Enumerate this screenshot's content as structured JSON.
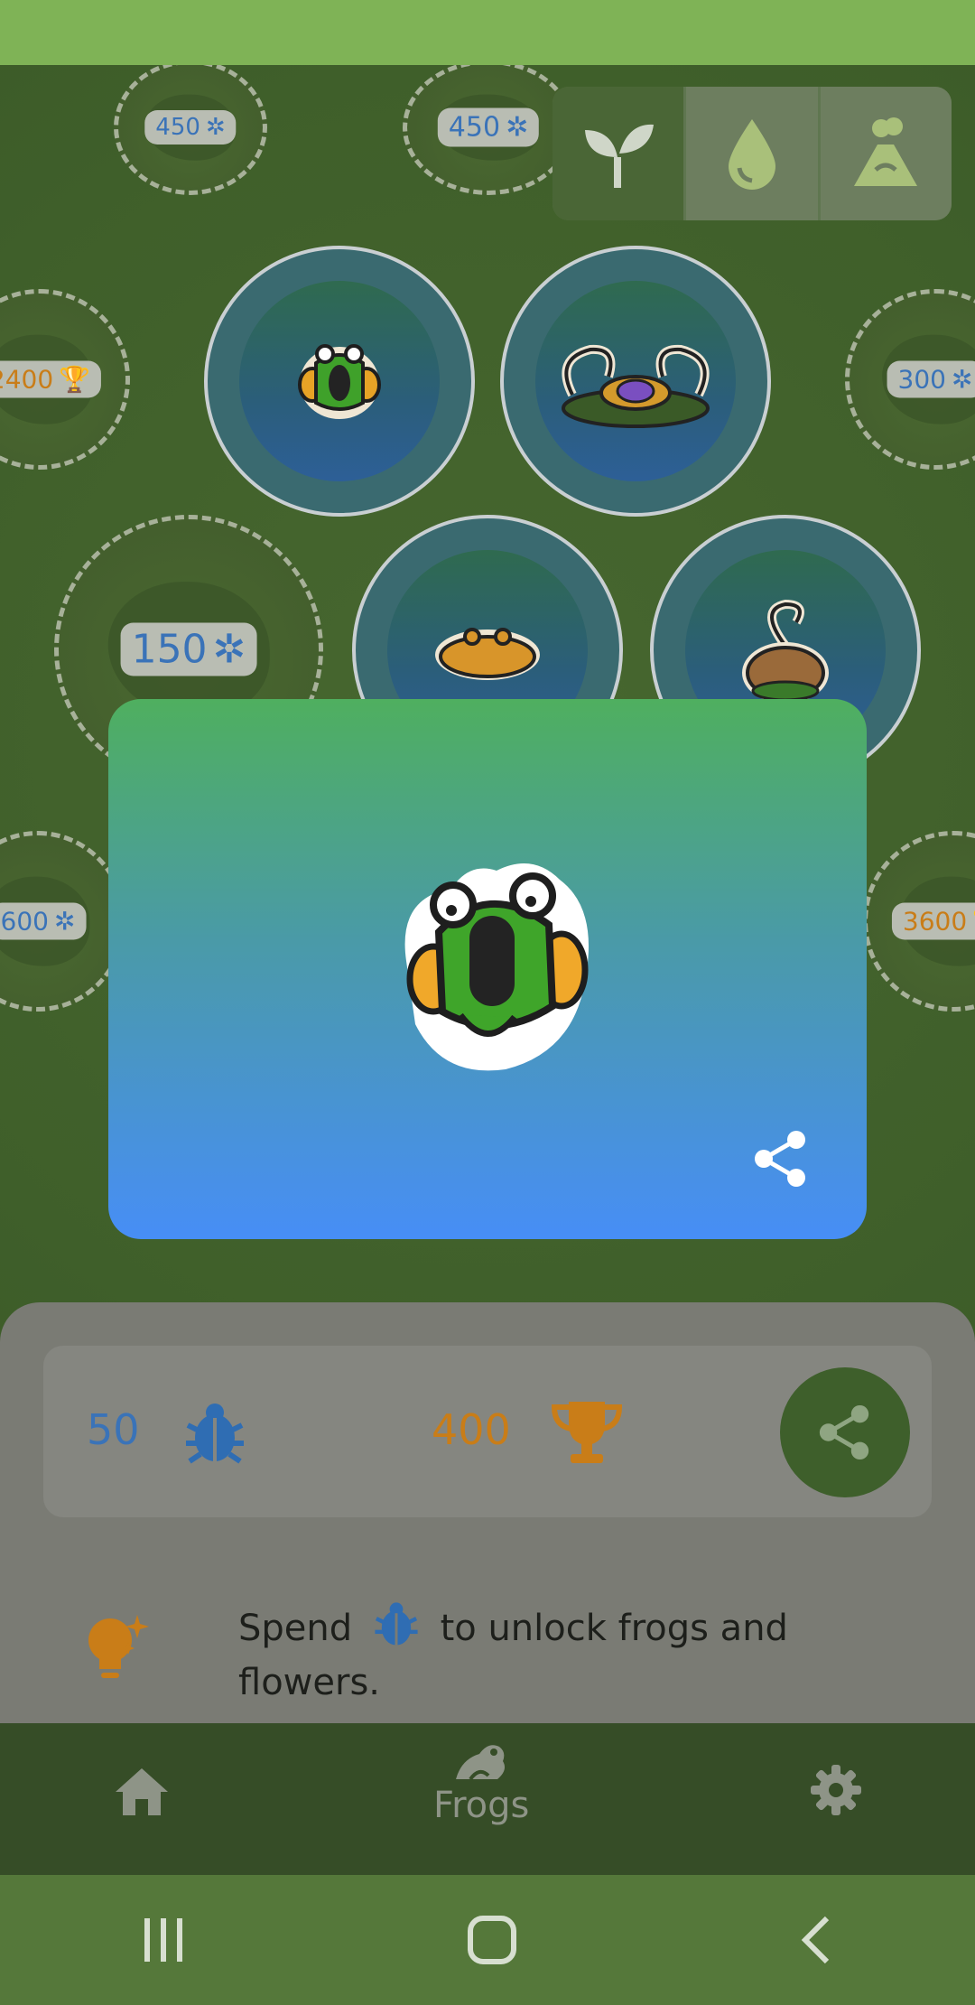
{
  "garden": {
    "locked_spots": [
      {
        "cost": "450",
        "currency": "bug"
      },
      {
        "cost": "450",
        "currency": "bug"
      },
      {
        "cost": "2400",
        "currency": "trophy"
      },
      {
        "cost": "300",
        "currency": "bug"
      },
      {
        "cost": "150",
        "currency": "bug"
      },
      {
        "cost": "600",
        "currency": "bug"
      },
      {
        "cost": "3600",
        "currency": "trophy"
      }
    ],
    "filter_tabs": [
      {
        "icon": "sprout-icon",
        "active": true
      },
      {
        "icon": "water-drop-icon",
        "active": false
      },
      {
        "icon": "volcano-icon",
        "active": false
      }
    ]
  },
  "card": {
    "frog_icon": "green-bell-frog",
    "share_icon": "share-icon"
  },
  "stats": {
    "bugs": "50",
    "trophies": "400"
  },
  "tip": {
    "text_before": "Spend",
    "text_after": "to unlock frogs and flowers."
  },
  "nav": {
    "home_icon": "home-icon",
    "frogs_label": "Frogs",
    "settings_icon": "gear-icon"
  },
  "colors": {
    "bug_blue": "#3a73b8",
    "trophy_orange": "#c97d18",
    "garden_green": "#3f5f2a",
    "accent_green": "#3e5f2b"
  }
}
